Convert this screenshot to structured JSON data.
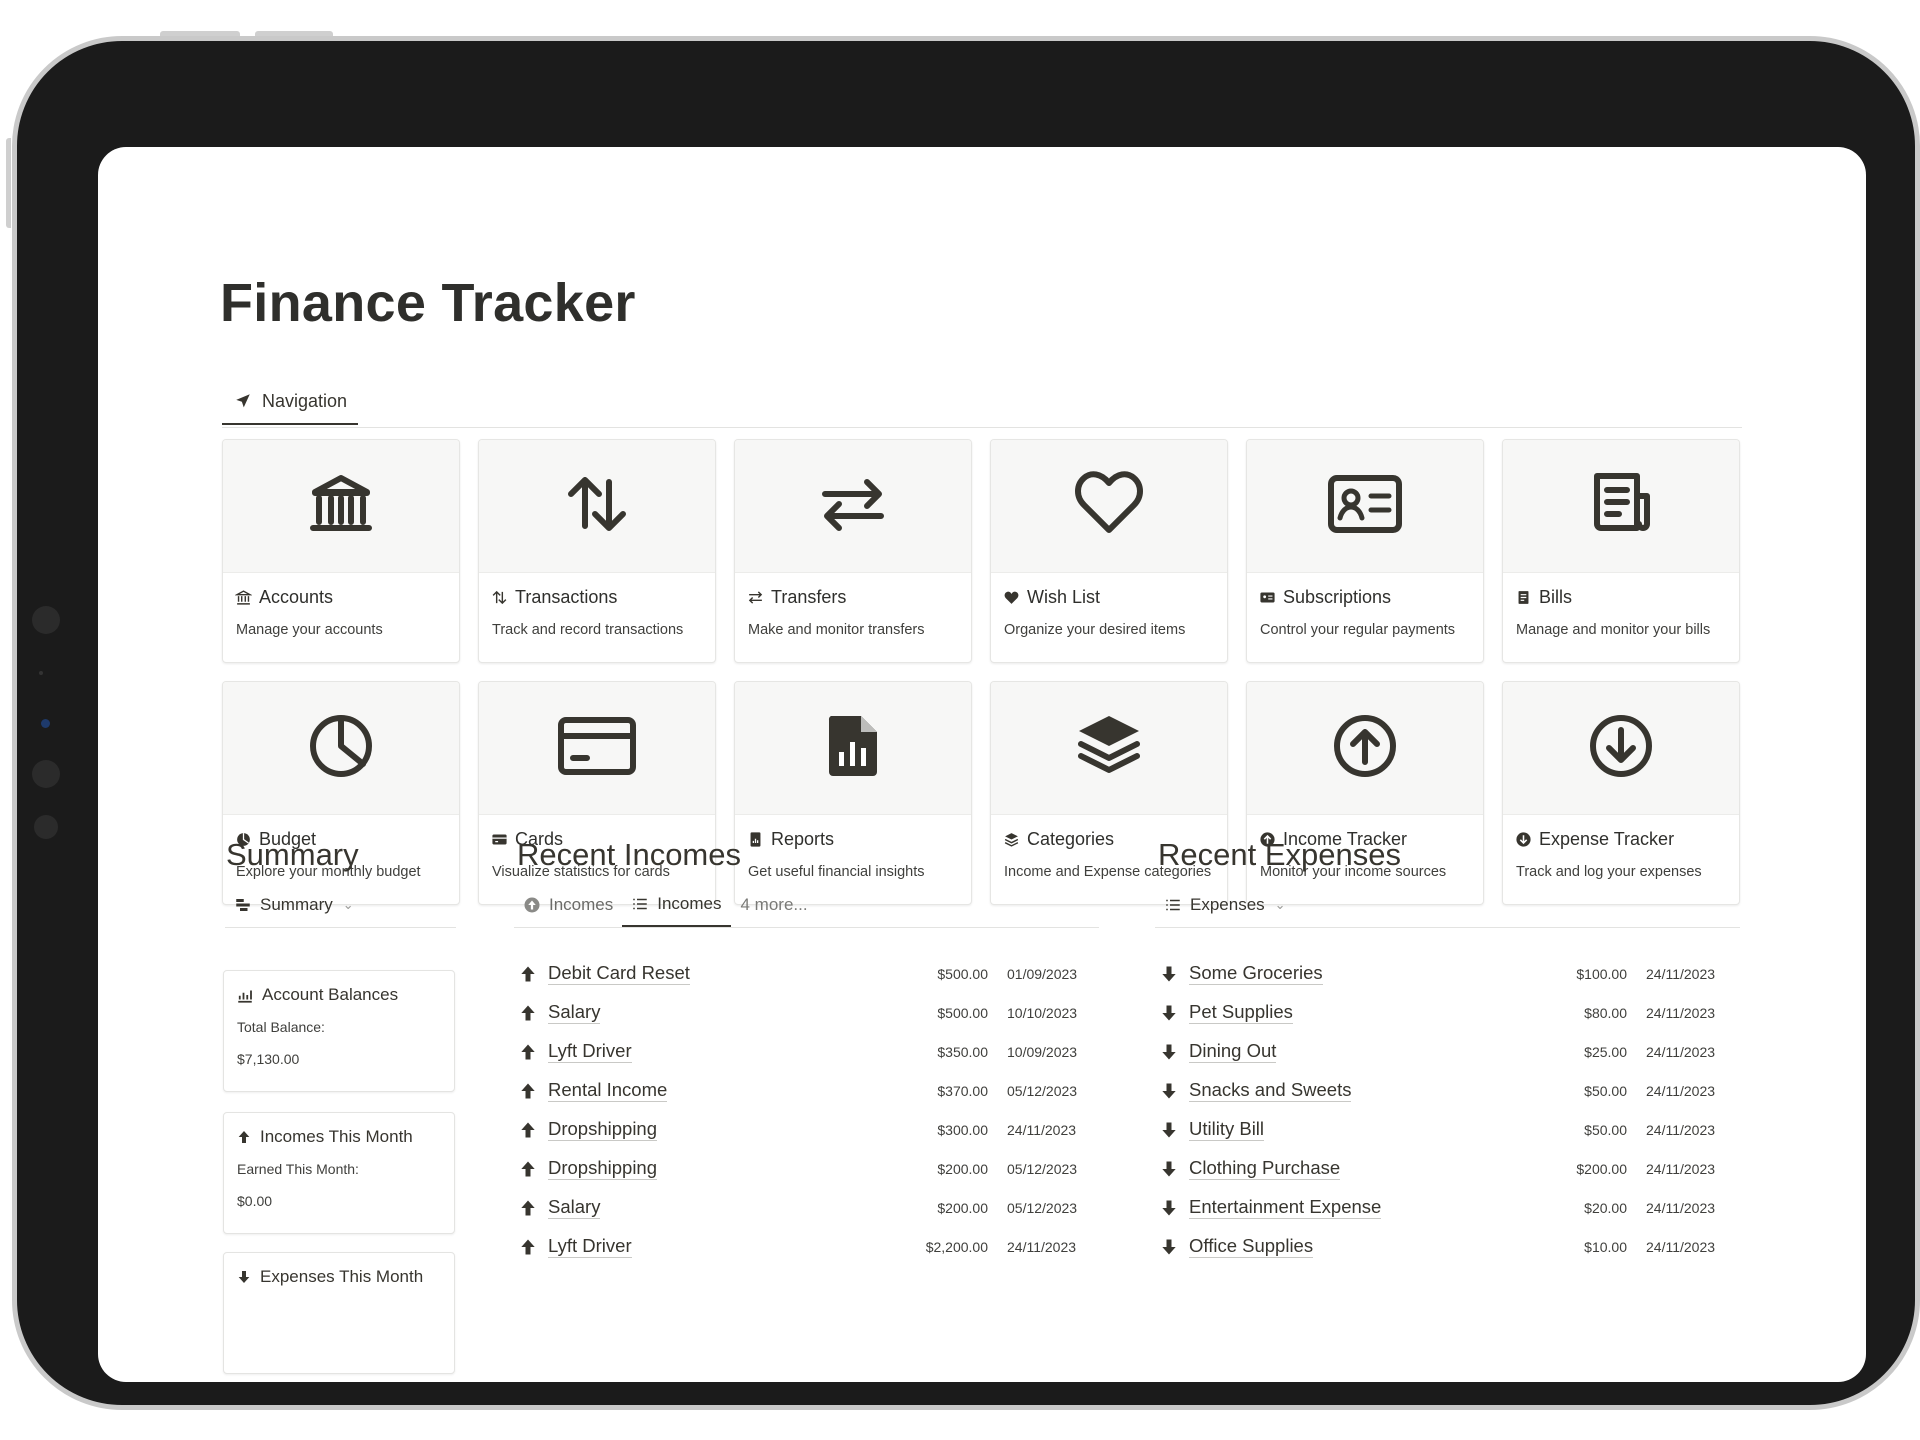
{
  "page": {
    "title": "Finance Tracker"
  },
  "navigation": {
    "tab_label": "Navigation"
  },
  "nav_cards": [
    {
      "key": "accounts",
      "title": "Accounts",
      "desc": "Manage your accounts",
      "icon": "bank-icon"
    },
    {
      "key": "transactions",
      "title": "Transactions",
      "desc": "Track and record transactions",
      "icon": "arrows-up-down-icon"
    },
    {
      "key": "transfers",
      "title": "Transfers",
      "desc": "Make and monitor transfers",
      "icon": "arrows-left-right-icon"
    },
    {
      "key": "wish-list",
      "title": "Wish List",
      "desc": "Organize your desired items",
      "icon": "heart-icon"
    },
    {
      "key": "subscriptions",
      "title": "Subscriptions",
      "desc": "Control your regular payments",
      "icon": "id-card-icon"
    },
    {
      "key": "bills",
      "title": "Bills",
      "desc": "Manage and monitor your bills",
      "icon": "receipt-icon"
    },
    {
      "key": "budget",
      "title": "Budget",
      "desc": "Explore your monthly budget",
      "icon": "pie-chart-icon"
    },
    {
      "key": "cards",
      "title": "Cards",
      "desc": "Visualize statistics for cards",
      "icon": "credit-card-icon"
    },
    {
      "key": "reports",
      "title": "Reports",
      "desc": "Get useful financial insights",
      "icon": "report-icon"
    },
    {
      "key": "categories",
      "title": "Categories",
      "desc": "Income and Expense categories",
      "icon": "layers-icon"
    },
    {
      "key": "income-tracker",
      "title": "Income Tracker",
      "desc": "Monitor your income sources",
      "icon": "arrow-up-circle-icon"
    },
    {
      "key": "expense-tracker",
      "title": "Expense Tracker",
      "desc": "Track and log your expenses",
      "icon": "arrow-down-circle-icon"
    }
  ],
  "summary": {
    "heading": "Summary",
    "view_label": "Summary",
    "cards": [
      {
        "title": "Account Balances",
        "label": "Total Balance:",
        "value": "$7,130.00",
        "icon": "bar-chart-icon"
      },
      {
        "title": "Incomes This Month",
        "label": "Earned This Month:",
        "value": "$0.00",
        "icon": "arrow-up-icon"
      },
      {
        "title": "Expenses This Month",
        "icon": "arrow-down-icon"
      }
    ]
  },
  "recent_incomes": {
    "heading": "Recent Incomes",
    "tabs": [
      "Incomes",
      "Incomes"
    ],
    "more": "4 more...",
    "rows": [
      {
        "name": "Debit Card Reset",
        "amount": "$500.00",
        "date": "01/09/2023"
      },
      {
        "name": "Salary",
        "amount": "$500.00",
        "date": "10/10/2023"
      },
      {
        "name": "Lyft Driver",
        "amount": "$350.00",
        "date": "10/09/2023"
      },
      {
        "name": "Rental Income",
        "amount": "$370.00",
        "date": "05/12/2023"
      },
      {
        "name": "Dropshipping",
        "amount": "$300.00",
        "date": "24/11/2023"
      },
      {
        "name": "Dropshipping",
        "amount": "$200.00",
        "date": "05/12/2023"
      },
      {
        "name": "Salary",
        "amount": "$200.00",
        "date": "05/12/2023"
      },
      {
        "name": "Lyft Driver",
        "amount": "$2,200.00",
        "date": "24/11/2023"
      }
    ]
  },
  "recent_expenses": {
    "heading": "Recent Expenses",
    "view_label": "Expenses",
    "rows": [
      {
        "name": "Some Groceries",
        "amount": "$100.00",
        "date": "24/11/2023"
      },
      {
        "name": "Pet Supplies",
        "amount": "$80.00",
        "date": "24/11/2023"
      },
      {
        "name": "Dining Out",
        "amount": "$25.00",
        "date": "24/11/2023"
      },
      {
        "name": "Snacks and Sweets",
        "amount": "$50.00",
        "date": "24/11/2023"
      },
      {
        "name": "Utility Bill",
        "amount": "$50.00",
        "date": "24/11/2023"
      },
      {
        "name": "Clothing Purchase",
        "amount": "$200.00",
        "date": "24/11/2023"
      },
      {
        "name": "Entertainment Expense",
        "amount": "$20.00",
        "date": "24/11/2023"
      },
      {
        "name": "Office Supplies",
        "amount": "$10.00",
        "date": "24/11/2023"
      }
    ]
  },
  "colors": {
    "text": "#37352f",
    "card_bg": "#f7f7f6",
    "border": "#e6e6e4",
    "device": "#1b1b1b"
  }
}
